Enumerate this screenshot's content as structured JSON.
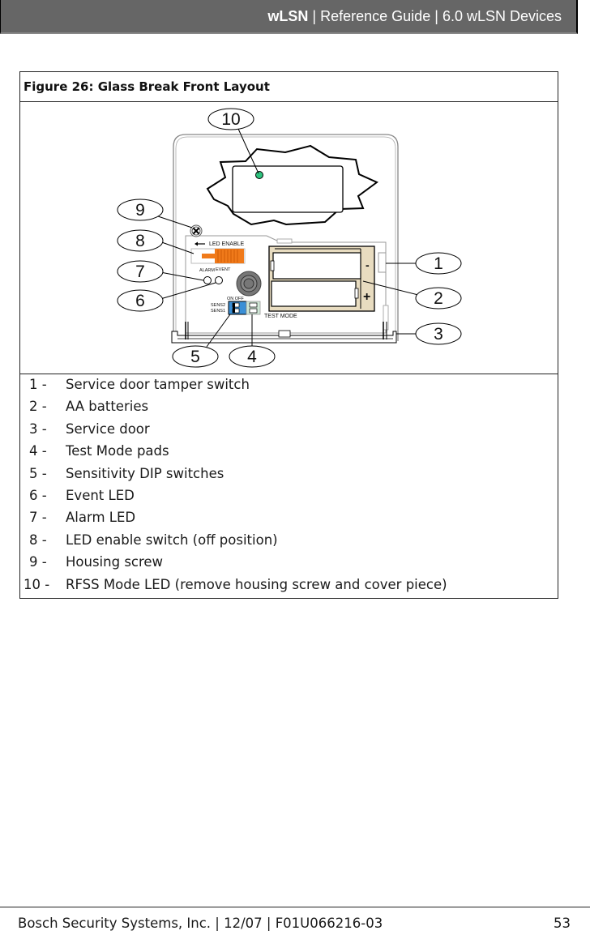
{
  "header": {
    "product": "wLSN",
    "separator": "|",
    "guide": "Reference Guide",
    "section": "6.0 wLSN Devices"
  },
  "figure": {
    "title": "Figure 26:  Glass Break Front Layout",
    "callouts": [
      "1",
      "2",
      "3",
      "4",
      "5",
      "6",
      "7",
      "8",
      "9",
      "10"
    ],
    "diagram_labels": {
      "led_enable": "LED ENABLE",
      "alarm": "ALARM",
      "event": "EVENT",
      "on_off": "ON OFF",
      "sens2": "SENS2",
      "sens1": "SENS1",
      "test_mode": "TEST MODE",
      "battery_minus": "-",
      "battery_plus": "+"
    },
    "colors": {
      "rfss_led": "#2ec27e",
      "led_switch": "#f07a1a",
      "dip_switch": "#3a8fd6",
      "test_pads": "#cfe8d6",
      "battery_tray": "#e8dcc0"
    },
    "legend": [
      {
        "num": "1 -",
        "text": "Service door tamper switch"
      },
      {
        "num": "2 -",
        "text": "AA batteries"
      },
      {
        "num": "3 -",
        "text": "Service door"
      },
      {
        "num": "4 -",
        "text": "Test Mode pads"
      },
      {
        "num": "5 -",
        "text": "Sensitivity DIP switches"
      },
      {
        "num": "6 -",
        "text": "Event LED"
      },
      {
        "num": "7 -",
        "text": "Alarm LED"
      },
      {
        "num": "8 -",
        "text": "LED enable switch (off position)"
      },
      {
        "num": "9 -",
        "text": "Housing screw"
      },
      {
        "num": "10 -",
        "text": "RFSS Mode LED (remove housing screw and cover piece)"
      }
    ]
  },
  "footer": {
    "text": "Bosch Security Systems, Inc. | 12/07 | F01U066216-03",
    "page_number": "53"
  }
}
